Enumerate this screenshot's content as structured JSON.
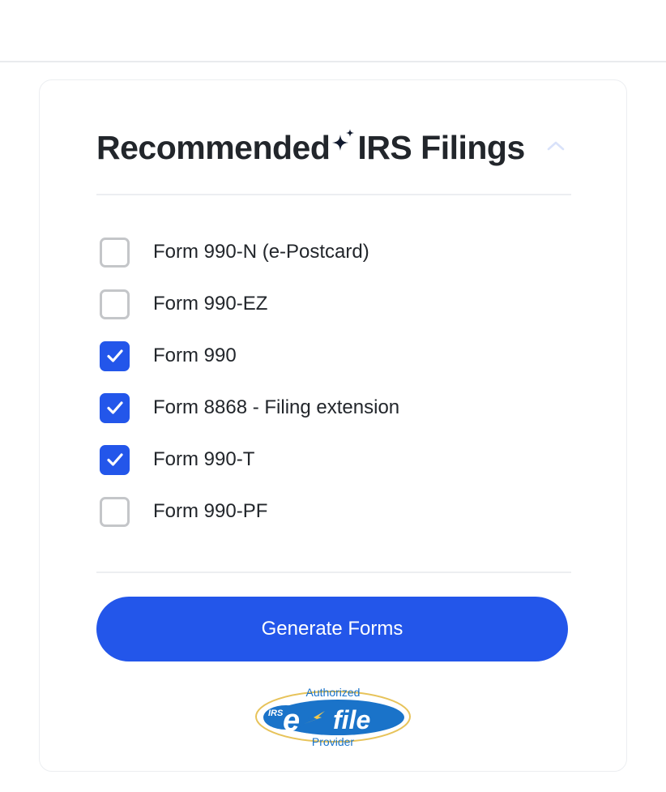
{
  "card": {
    "title_part1": "Recommended",
    "title_part2": "IRS Filings",
    "sparkle_icon": "sparkle-icon",
    "collapse_icon": "chevron-up-icon",
    "forms": [
      {
        "label": "Form 990-N (e-Postcard)",
        "checked": false
      },
      {
        "label": "Form 990-EZ",
        "checked": false
      },
      {
        "label": "Form 990",
        "checked": true
      },
      {
        "label": "Form 8868 - Filing extension",
        "checked": true
      },
      {
        "label": "Form 990-T",
        "checked": true
      },
      {
        "label": "Form 990-PF",
        "checked": false
      }
    ],
    "generate_label": "Generate Forms",
    "badge": {
      "top_text": "Authorized",
      "irs_text": "IRS",
      "e_text": "e",
      "file_text": "file",
      "bottom_text": "Provider"
    }
  },
  "colors": {
    "accent": "#2356ea",
    "checkbox_border": "#c4c6c9",
    "text": "#22262b"
  }
}
